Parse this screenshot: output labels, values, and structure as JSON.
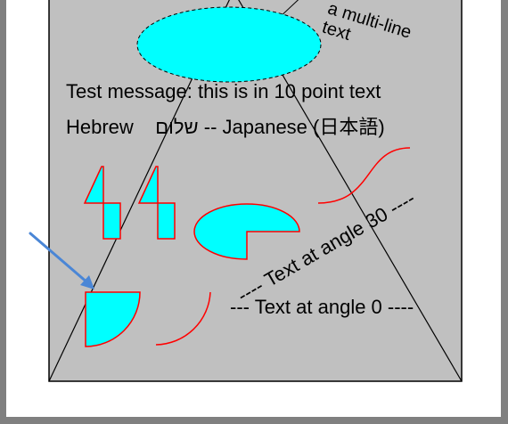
{
  "canvas": {
    "multiline_text": [
      "a multi-line",
      "text"
    ],
    "test_message": "Test message: this is in 10 point text",
    "hebrew_line": "Hebrew    שלום -- Japanese (日本語)",
    "angle30_text": "---- Text at angle 30 ----",
    "angle0_text": "--- Text at angle 0 ----"
  },
  "colors": {
    "window_gray": "#808080",
    "paper": "#ffffff",
    "page_fill": "#c0c0c0",
    "shape_fill": "#00ffff",
    "shape_outline": "#ff0000",
    "arrow": "#4a86d6"
  },
  "icons": [
    "arrow-pointer-icon"
  ]
}
